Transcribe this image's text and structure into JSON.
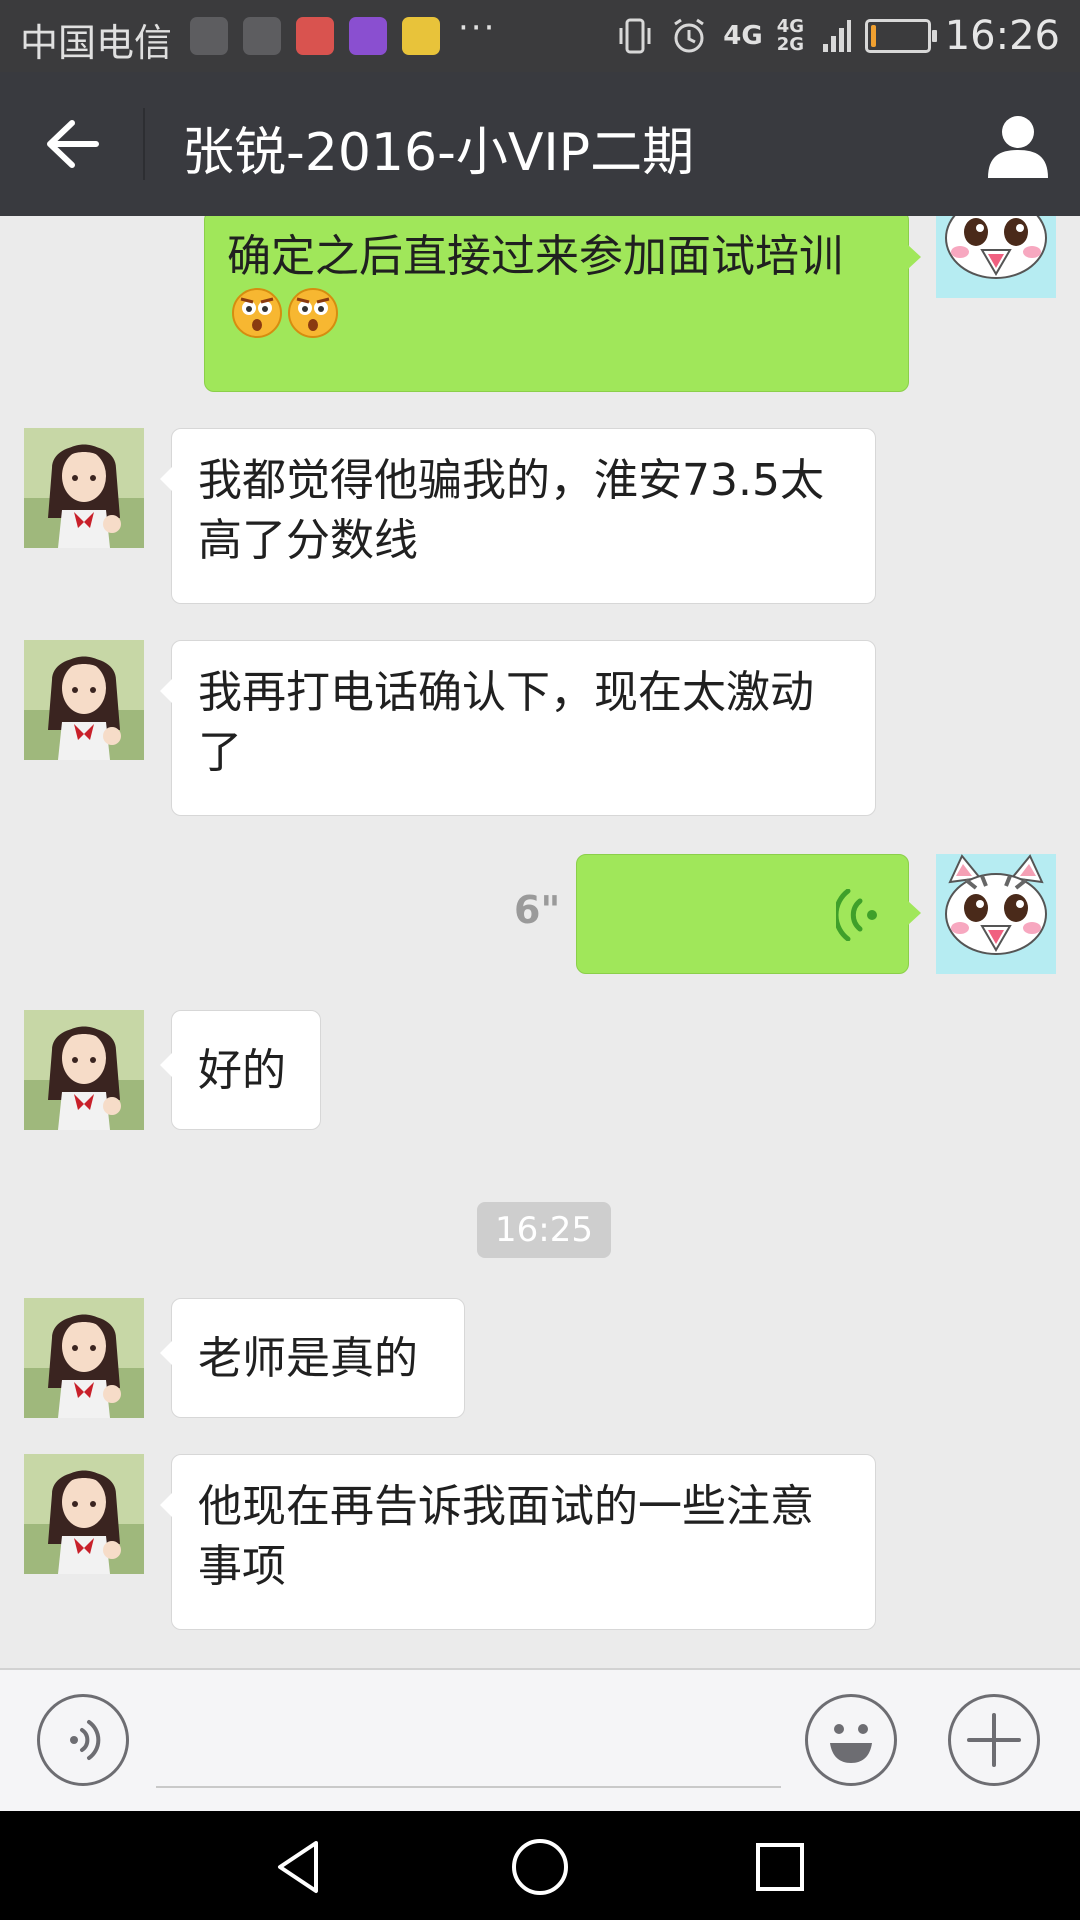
{
  "status_bar": {
    "carrier": "中国电信",
    "more": "···",
    "network": "4G",
    "network_secondary": "4G 2G",
    "battery_level": 0.1,
    "time": "16:26",
    "notification_icons": [
      "app-notification-icon",
      "app-notification-icon",
      "alert-app-icon",
      "gallery-app-icon",
      "minion-app-icon"
    ],
    "icons": [
      "vibrate-icon",
      "alarm-icon",
      "signal-icon",
      "battery-icon"
    ]
  },
  "header": {
    "title": "张锐-2016-小VIP二期",
    "back_icon": "arrow-left-icon",
    "profile_icon": "person-icon"
  },
  "messages": [
    {
      "side": "right",
      "type": "text",
      "text": "确定之后直接过来参加面试培训",
      "emojis": 2
    },
    {
      "side": "left",
      "type": "text",
      "text": "我都觉得他骗我的，淮安73.5太高了分数线"
    },
    {
      "side": "left",
      "type": "text",
      "text": "我再打电话确认下，现在太激动了"
    },
    {
      "side": "right",
      "type": "voice",
      "duration": "6\""
    },
    {
      "side": "left",
      "type": "text",
      "text": "好的"
    },
    {
      "side": "center",
      "type": "time",
      "text": "16:25"
    },
    {
      "side": "left",
      "type": "text",
      "text": "老师是真的"
    },
    {
      "side": "left",
      "type": "text",
      "text": "他现在再告诉我面试的一些注意事项"
    }
  ],
  "input_bar": {
    "voice_icon": "voice-input-icon",
    "emoji_icon": "emoji-icon",
    "more_icon": "plus-icon"
  },
  "nav_bar": {
    "icons": [
      "back-triangle-icon",
      "home-circle-icon",
      "recents-square-icon"
    ]
  },
  "colors": {
    "chat_background": "#ebebeb",
    "header": "#393a3f",
    "sent_bubble": "#a0e75a",
    "received_bubble": "#ffffff"
  }
}
